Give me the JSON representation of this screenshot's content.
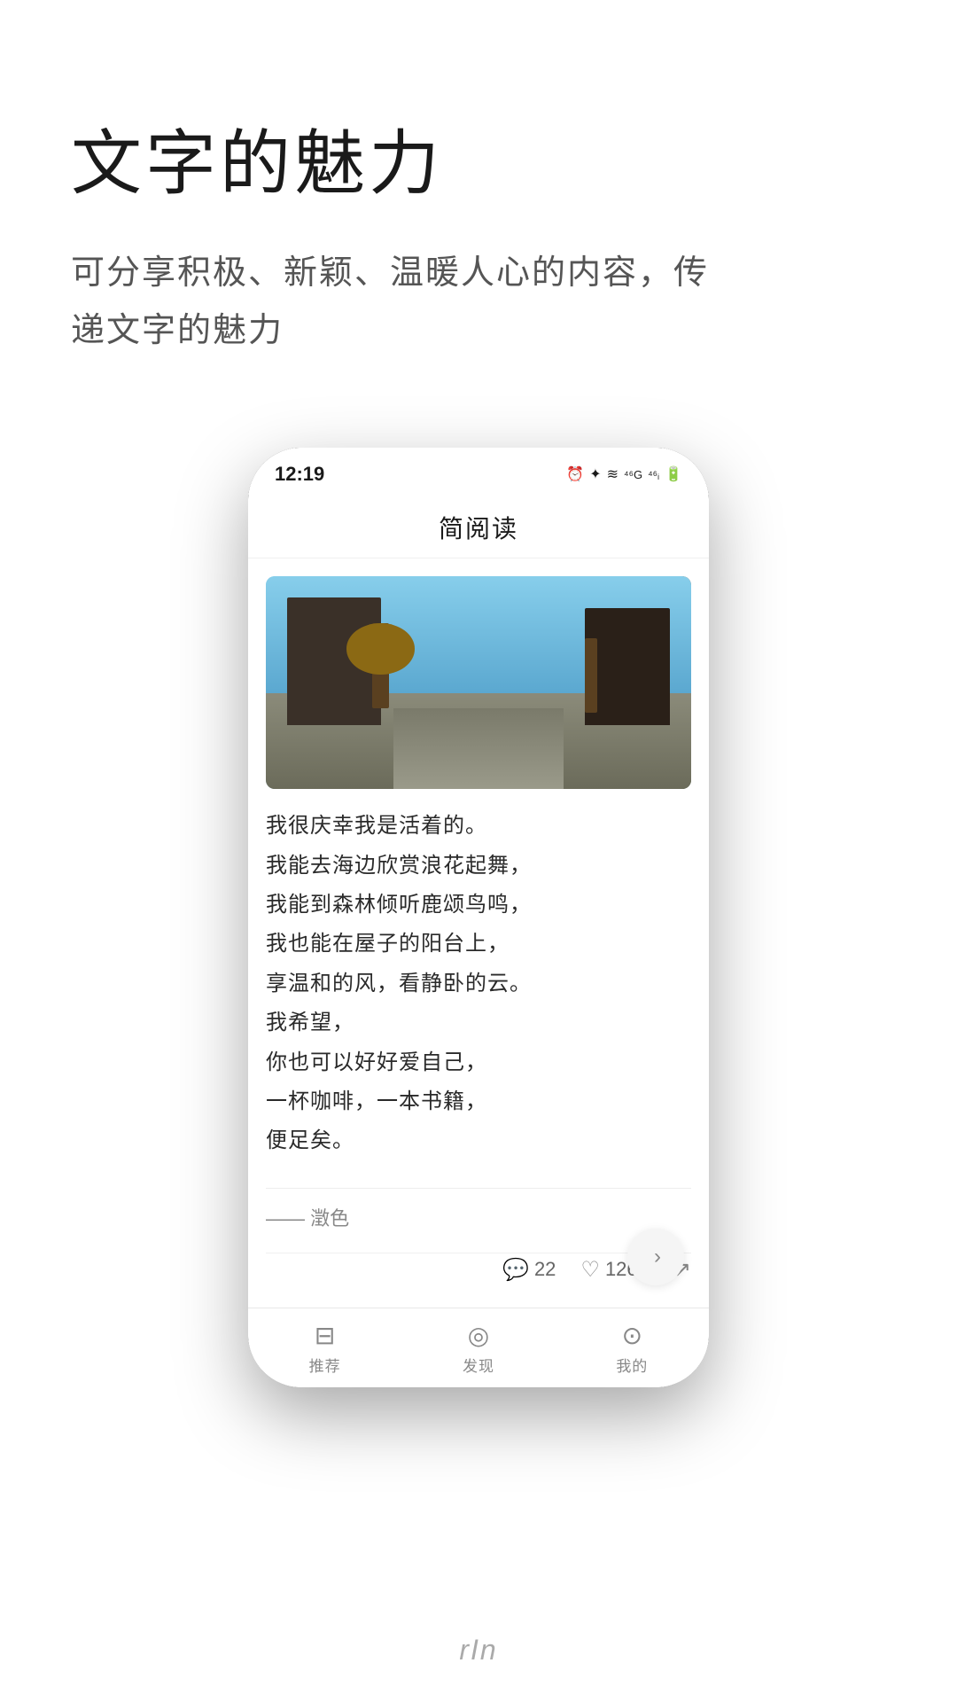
{
  "page": {
    "bg_color": "#ffffff"
  },
  "hero": {
    "title": "文字的魅力",
    "subtitle": "可分享积极、新颖、温暖人心的内容，传\n递文字的魅力"
  },
  "phone": {
    "status_bar": {
      "time": "12:19",
      "nfc_icon": "N",
      "icons": "⏰ ✦ )) ≋ ᵍ⁴⁶ ⁴⁶ᵍ"
    },
    "app_title": "简阅读",
    "article": {
      "text_lines": [
        "我很庆幸我是活着的。",
        "我能去海边欣赏浪花起舞，",
        "我能到森林倾听鹿颂鸟鸣，",
        "我也能在屋子的阳台上，",
        "享温和的风，看静卧的云。",
        "我希望，",
        "你也可以好好爱自己，",
        "一杯咖啡，一本书籍，",
        "便足矣。"
      ],
      "author": "—— 澂色",
      "comment_count": "22",
      "like_count": "1265"
    },
    "nav": {
      "items": [
        {
          "label": "推荐",
          "icon": "🖥"
        },
        {
          "label": "发现",
          "icon": "🧭"
        },
        {
          "label": "我的",
          "icon": "👤"
        }
      ]
    },
    "next_button_icon": "›",
    "bottom_hint": "rIn"
  }
}
